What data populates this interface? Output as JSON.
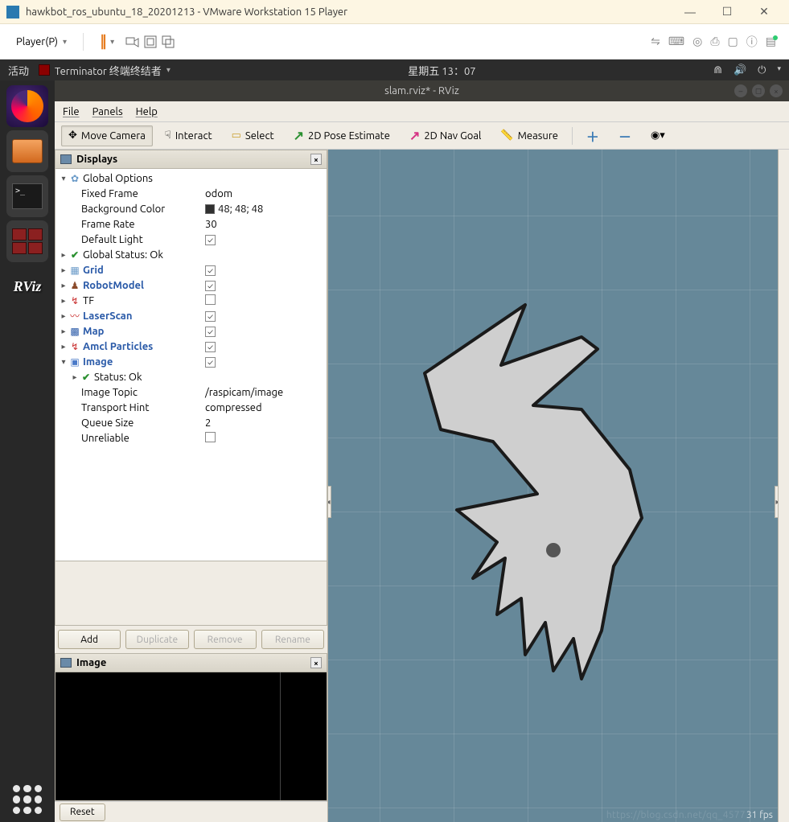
{
  "vmware": {
    "title": "hawkbot_ros_ubuntu_18_20201213 - VMware Workstation 15 Player",
    "player_label": "Player(P)"
  },
  "ubuntu": {
    "activities": "活动",
    "app_title": "Terminator 终端终结者",
    "clock": "星期五 13：07"
  },
  "dock": {
    "rviz_label": "RViz"
  },
  "rviz": {
    "title": "slam.rviz* - RViz",
    "menu": {
      "file": "File",
      "panels": "Panels",
      "help": "Help"
    },
    "toolbar": {
      "move_camera": "Move Camera",
      "interact": "Interact",
      "select": "Select",
      "pose_estimate": "2D Pose Estimate",
      "nav_goal": "2D Nav Goal",
      "measure": "Measure"
    },
    "panels": {
      "displays_title": "Displays",
      "image_title": "Image"
    },
    "tree": {
      "global_options": "Global Options",
      "fixed_frame_label": "Fixed Frame",
      "fixed_frame_value": "odom",
      "bg_color_label": "Background Color",
      "bg_color_value": "48; 48; 48",
      "frame_rate_label": "Frame Rate",
      "frame_rate_value": "30",
      "default_light_label": "Default Light",
      "global_status": "Global Status: Ok",
      "grid": "Grid",
      "robot_model": "RobotModel",
      "tf": "TF",
      "laser_scan": "LaserScan",
      "map": "Map",
      "amcl": "Amcl Particles",
      "image": "Image",
      "image_status": "Status: Ok",
      "image_topic_label": "Image Topic",
      "image_topic_value": "/raspicam/image",
      "transport_hint_label": "Transport Hint",
      "transport_hint_value": "compressed",
      "queue_size_label": "Queue Size",
      "queue_size_value": "2",
      "unreliable_label": "Unreliable"
    },
    "buttons": {
      "add": "Add",
      "duplicate": "Duplicate",
      "remove": "Remove",
      "rename": "Rename",
      "reset": "Reset"
    },
    "status": {
      "fps": "31 fps",
      "watermark": "https://blog.csdn.net/qq_4577"
    }
  }
}
